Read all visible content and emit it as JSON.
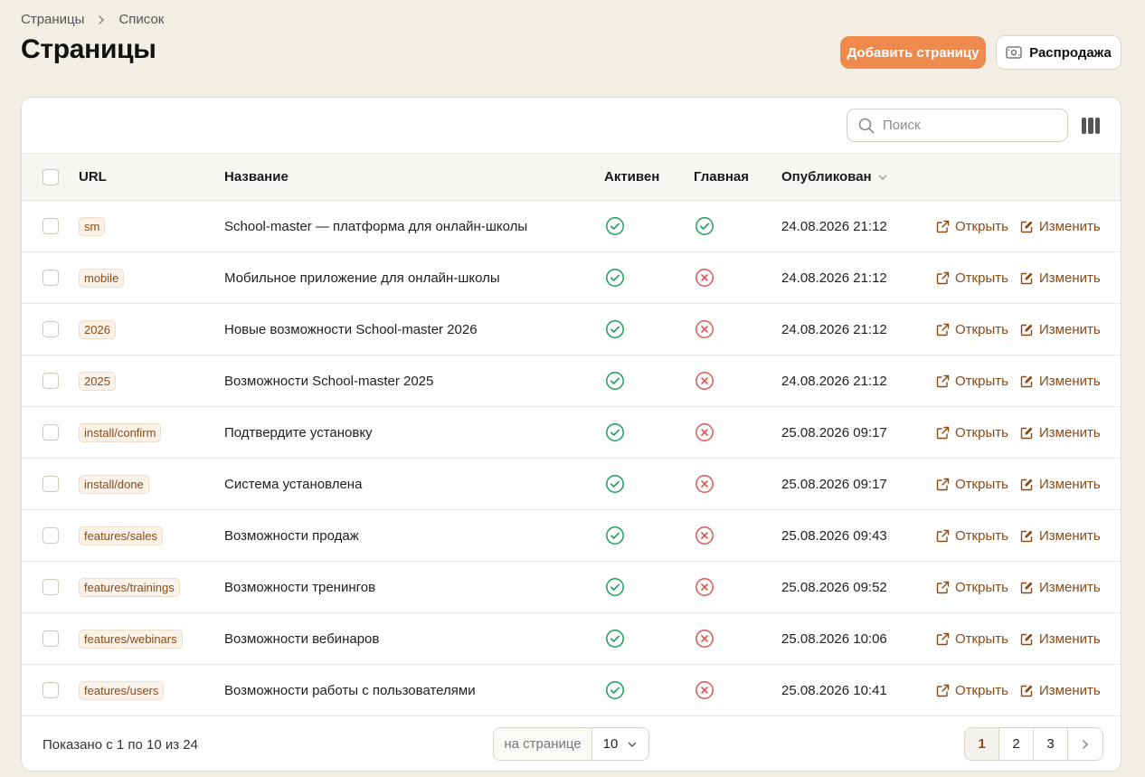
{
  "breadcrumb": {
    "root": "Страницы",
    "current": "Список"
  },
  "page_title": "Страницы",
  "header_buttons": {
    "add_page": "Добавить страницу",
    "sale": "Распродажа"
  },
  "search": {
    "placeholder": "Поиск",
    "value": ""
  },
  "table": {
    "columns": {
      "url": "URL",
      "name": "Название",
      "active": "Активен",
      "main": "Главная",
      "published": "Опубликован"
    },
    "actions": {
      "open": "Открыть",
      "edit": "Изменить"
    },
    "rows": [
      {
        "url": "sm",
        "name": "School-master — платформа для онлайн-школы",
        "active": true,
        "main": true,
        "published": "24.08.2026 21:12"
      },
      {
        "url": "mobile",
        "name": "Мобильное приложение для онлайн-школы",
        "active": true,
        "main": false,
        "published": "24.08.2026 21:12"
      },
      {
        "url": "2026",
        "name": "Новые возможности School-master 2026",
        "active": true,
        "main": false,
        "published": "24.08.2026 21:12"
      },
      {
        "url": "2025",
        "name": "Возможности School-master 2025",
        "active": true,
        "main": false,
        "published": "24.08.2026 21:12"
      },
      {
        "url": "install/confirm",
        "name": "Подтвердите установку",
        "active": true,
        "main": false,
        "published": "25.08.2026 09:17"
      },
      {
        "url": "install/done",
        "name": "Система установлена",
        "active": true,
        "main": false,
        "published": "25.08.2026 09:17"
      },
      {
        "url": "features/sales",
        "name": "Возможности продаж",
        "active": true,
        "main": false,
        "published": "25.08.2026 09:43"
      },
      {
        "url": "features/trainings",
        "name": "Возможности тренингов",
        "active": true,
        "main": false,
        "published": "25.08.2026 09:52"
      },
      {
        "url": "features/webinars",
        "name": "Возможности вебинаров",
        "active": true,
        "main": false,
        "published": "25.08.2026 10:06"
      },
      {
        "url": "features/users",
        "name": "Возможности работы с пользователями",
        "active": true,
        "main": false,
        "published": "25.08.2026 10:41"
      }
    ]
  },
  "footer": {
    "info": "Показано с 1 по 10 из 24",
    "per_page_label": "на странице",
    "per_page_value": "10",
    "pages": [
      "1",
      "2",
      "3"
    ],
    "current_page": "1"
  },
  "colors": {
    "accent": "#ef8a4f",
    "link": "#8a4a16",
    "success": "#1e9e5a",
    "danger": "#e05555",
    "background": "#f3eee3"
  }
}
